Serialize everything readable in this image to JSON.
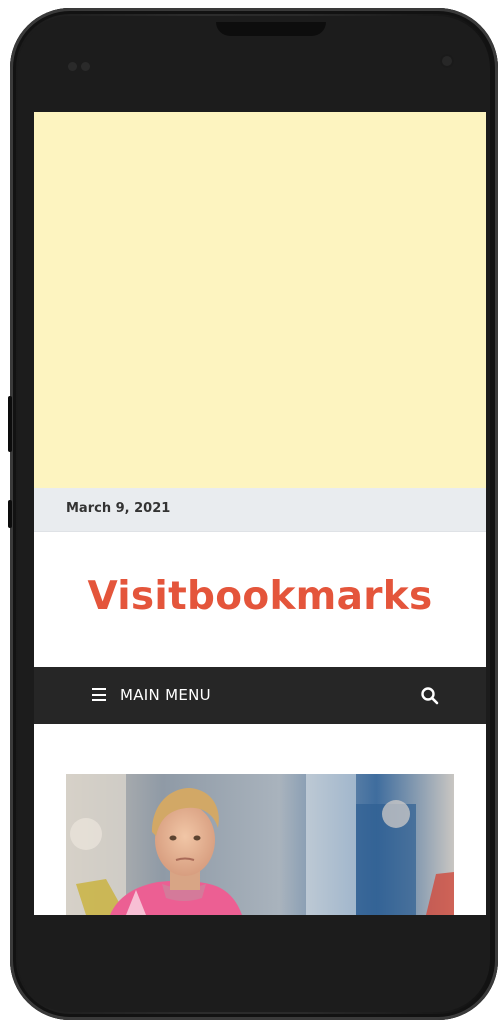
{
  "date": "March 9, 2021",
  "site": {
    "title": "Visitbookmarks"
  },
  "nav": {
    "menu_label": "MAIN MENU"
  },
  "icons": {
    "menu": "hamburger-menu-icon",
    "search": "search-icon"
  },
  "colors": {
    "title": "#e4553b",
    "nav_background": "#262626",
    "ad_background": "#fdf4c0",
    "date_bar": "#e9ecef"
  }
}
